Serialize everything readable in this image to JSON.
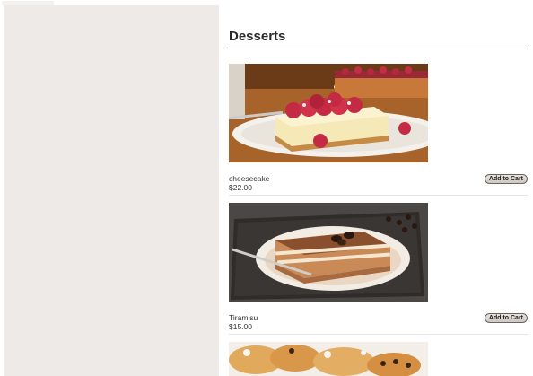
{
  "section": {
    "title": "Desserts"
  },
  "products": [
    {
      "name": "cheesecake",
      "price": "$22.00",
      "button_label": "Add to Cart",
      "image": "cheesecake-photo"
    },
    {
      "name": "Tiramisu",
      "price": "$15.00",
      "button_label": "Add to Cart",
      "image": "tiramisu-photo"
    },
    {
      "image": "pastry-photo"
    }
  ]
}
